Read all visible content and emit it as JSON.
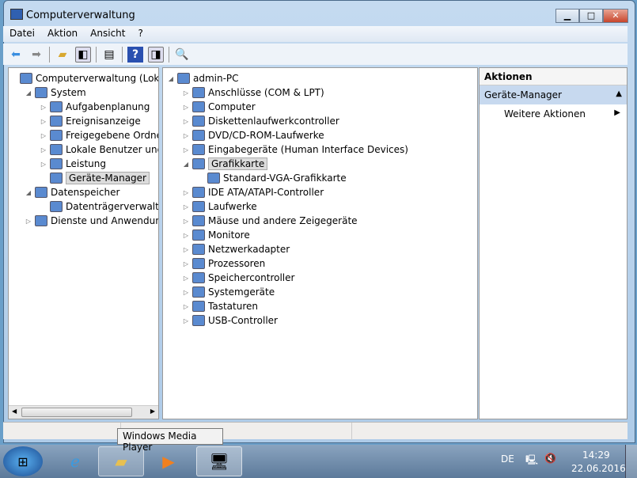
{
  "window": {
    "title": "Computerverwaltung",
    "minimize": "▁",
    "maximize": "□",
    "close": "✕"
  },
  "menu": [
    "Datei",
    "Aktion",
    "Ansicht",
    "?"
  ],
  "left_tree": [
    {
      "label": "Computerverwaltung (Lokal)",
      "level": 0,
      "exp": ""
    },
    {
      "label": "System",
      "level": 1,
      "exp": "◢"
    },
    {
      "label": "Aufgabenplanung",
      "level": 2,
      "exp": "▷"
    },
    {
      "label": "Ereignisanzeige",
      "level": 2,
      "exp": "▷"
    },
    {
      "label": "Freigegebene Ordner",
      "level": 2,
      "exp": "▷"
    },
    {
      "label": "Lokale Benutzer und Gruppen",
      "level": 2,
      "exp": "▷"
    },
    {
      "label": "Leistung",
      "level": 2,
      "exp": "▷"
    },
    {
      "label": "Geräte-Manager",
      "level": 2,
      "exp": "",
      "selected": true
    },
    {
      "label": "Datenspeicher",
      "level": 1,
      "exp": "◢"
    },
    {
      "label": "Datenträgerverwaltung",
      "level": 2,
      "exp": ""
    },
    {
      "label": "Dienste und Anwendungen",
      "level": 1,
      "exp": "▷"
    }
  ],
  "device_tree": [
    {
      "label": "admin-PC",
      "level": 0,
      "exp": "◢"
    },
    {
      "label": "Anschlüsse (COM & LPT)",
      "level": 1,
      "exp": "▷"
    },
    {
      "label": "Computer",
      "level": 1,
      "exp": "▷"
    },
    {
      "label": "Diskettenlaufwerkcontroller",
      "level": 1,
      "exp": "▷"
    },
    {
      "label": "DVD/CD-ROM-Laufwerke",
      "level": 1,
      "exp": "▷"
    },
    {
      "label": "Eingabegeräte (Human Interface Devices)",
      "level": 1,
      "exp": "▷"
    },
    {
      "label": "Grafikkarte",
      "level": 1,
      "exp": "◢",
      "selected": true
    },
    {
      "label": "Standard-VGA-Grafikkarte",
      "level": 2,
      "exp": ""
    },
    {
      "label": "IDE ATA/ATAPI-Controller",
      "level": 1,
      "exp": "▷"
    },
    {
      "label": "Laufwerke",
      "level": 1,
      "exp": "▷"
    },
    {
      "label": "Mäuse und andere Zeigegeräte",
      "level": 1,
      "exp": "▷"
    },
    {
      "label": "Monitore",
      "level": 1,
      "exp": "▷"
    },
    {
      "label": "Netzwerkadapter",
      "level": 1,
      "exp": "▷"
    },
    {
      "label": "Prozessoren",
      "level": 1,
      "exp": "▷"
    },
    {
      "label": "Speichercontroller",
      "level": 1,
      "exp": "▷"
    },
    {
      "label": "Systemgeräte",
      "level": 1,
      "exp": "▷"
    },
    {
      "label": "Tastaturen",
      "level": 1,
      "exp": "▷"
    },
    {
      "label": "USB-Controller",
      "level": 1,
      "exp": "▷"
    }
  ],
  "actions": {
    "header": "Aktionen",
    "section": "Geräte-Manager",
    "more": "Weitere Aktionen"
  },
  "tooltip": "Windows Media Player",
  "tray": {
    "lang": "DE",
    "time": "14:29",
    "date": "22.06.2016"
  }
}
